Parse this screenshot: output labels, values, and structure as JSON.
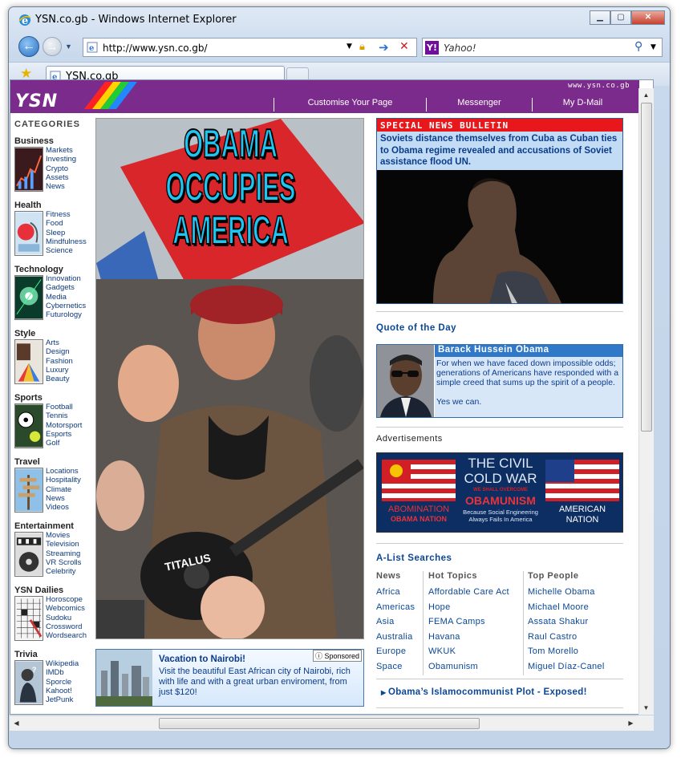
{
  "window": {
    "title": "YSN.co.gb - Windows Internet Explorer"
  },
  "address": {
    "url": "http://www.ysn.co.gb/"
  },
  "search": {
    "placeholder": "Yahoo!"
  },
  "tab": {
    "label": "YSN.co.gb"
  },
  "header": {
    "site_url": "www.ysn.co.gb",
    "logo": "YSN",
    "nav": [
      "Customise Your Page",
      "Messenger",
      "My D-Mail"
    ]
  },
  "categories": {
    "title": "CATEGORIES",
    "groups": [
      {
        "name": "Business",
        "links": [
          "Markets",
          "Investing",
          "Crypto",
          "Assets",
          "News"
        ]
      },
      {
        "name": "Health",
        "links": [
          "Fitness",
          "Food",
          "Sleep",
          "Mindfulness",
          "Science"
        ]
      },
      {
        "name": "Technology",
        "links": [
          "Innovation",
          "Gadgets",
          "Media",
          "Cybernetics",
          "Futurology"
        ]
      },
      {
        "name": "Style",
        "links": [
          "Arts",
          "Design",
          "Fashion",
          "Luxury",
          "Beauty"
        ]
      },
      {
        "name": "Sports",
        "links": [
          "Football",
          "Tennis",
          "Motorsport",
          "Esports",
          "Golf"
        ]
      },
      {
        "name": "Travel",
        "links": [
          "Locations",
          "Hospitality",
          "Climate",
          "News",
          "Videos"
        ]
      },
      {
        "name": "Entertainment",
        "links": [
          "Movies",
          "Television",
          "Streaming",
          "VR Scrolls",
          "Celebrity"
        ]
      },
      {
        "name": "YSN Dailies",
        "links": [
          "Horoscope",
          "Webcomics",
          "Sudoku",
          "Crossword",
          "Wordsearch"
        ]
      },
      {
        "name": "Trivia",
        "links": [
          "Wikipedia",
          "IMDb",
          "Sporcle",
          "Kahoot!",
          "JetPunk"
        ]
      }
    ]
  },
  "hero": {
    "headline_l1": "OBAMA",
    "headline_l2": "OCCUPIES",
    "headline_l3": "AMERICA",
    "guitar_text": "TITALUS"
  },
  "vacation": {
    "title": "Vacation to Nairobi!",
    "body": "Visit the beautiful East African city of Nairobi, rich with life and with a great urban enviroment, from just $120!",
    "sponsored": "Sponsored"
  },
  "bulletin": {
    "header": "SPECIAL NEWS BULLETIN",
    "text": "Soviets distance themselves from Cuba as Cuban ties to Obama regime revealed and accusations of Soviet assistance flood UN."
  },
  "quote": {
    "section": "Quote of the Day",
    "name": "Barack Hussein Obama",
    "text": "For when we have faced down impossible odds; generations of Americans have responded with a simple creed that sums up the spirit of a people.",
    "signoff": "Yes we can."
  },
  "ads": {
    "label": "Advertisements",
    "l1": "THE CIVIL",
    "l2": "COLD WAR",
    "l3": "WE SHALL OVERCOME",
    "l4": "OBAMUNISM",
    "l5": "Because Social Engineering",
    "l6": "Always Fails In America",
    "left1": "ABOMINATION",
    "left2": "OBAMA NATION",
    "right1": "AMERICAN",
    "right2": "NATION"
  },
  "alist": {
    "title": "A-List Searches",
    "columns": [
      {
        "header": "News",
        "items": [
          "Africa",
          "Americas",
          "Asia",
          "Australia",
          "Europe",
          "Space"
        ]
      },
      {
        "header": "Hot Topics",
        "items": [
          "Affordable Care Act",
          "Hope",
          "FEMA Camps",
          "Havana",
          "WKUK",
          "Obamunism"
        ]
      },
      {
        "header": "Top People",
        "items": [
          "Michelle Obama",
          "Michael Moore",
          "Assata Shakur",
          "Raul Castro",
          "Tom Morello",
          "Miguel Díaz-Canel"
        ]
      }
    ]
  },
  "plot_link": "Obama’s Islamocommunist Plot - Exposed!"
}
